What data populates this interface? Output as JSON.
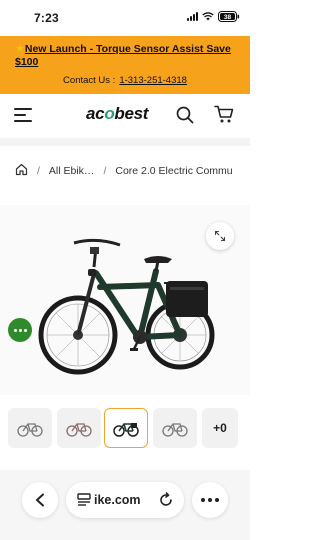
{
  "status_bar": {
    "time": "7:23",
    "battery": "38"
  },
  "promo": {
    "icon": "star-emoji",
    "title": "New Launch - Torque Sensor Assist Save $100",
    "contact_label": "Contact Us :",
    "phone": "1-313-251-4318",
    "background_color": "#f7a21b"
  },
  "header": {
    "logo_prefix": "ac",
    "logo_accent": "o",
    "logo_suffix": "best",
    "logo_accent_color": "#2f9e6e"
  },
  "breadcrumb": {
    "items": [
      "All Ebik…",
      "Core 2.0 Electric Commu"
    ]
  },
  "gallery": {
    "thumbnail_count_extra": "+0",
    "active_thumbnail_index": 2,
    "active_border_color": "#f0a330"
  },
  "browser": {
    "url": "ike.com"
  },
  "chat": {
    "color": "#2f8a2c"
  }
}
